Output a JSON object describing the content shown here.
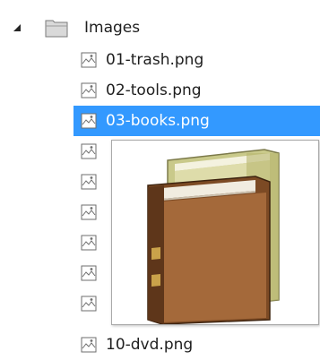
{
  "tree": {
    "folder": {
      "label": "Images",
      "icon": "folder-icon",
      "expanded": true
    },
    "files": [
      {
        "label": "01-trash.png",
        "icon": "image-file-icon"
      },
      {
        "label": "02-tools.png",
        "icon": "image-file-icon"
      },
      {
        "label": "03-books.png",
        "icon": "image-file-icon",
        "selected": true
      },
      {
        "label": "",
        "icon": "image-file-icon"
      },
      {
        "label": "",
        "icon": "image-file-icon"
      },
      {
        "label": "",
        "icon": "image-file-icon"
      },
      {
        "label": "",
        "icon": "image-file-icon"
      },
      {
        "label": "",
        "icon": "image-file-icon"
      },
      {
        "label": "",
        "icon": "image-file-icon"
      },
      {
        "label": "10-dvd.png",
        "icon": "image-file-icon"
      }
    ]
  },
  "preview": {
    "image": "books-icon"
  },
  "colors": {
    "selection": "#3399ff",
    "selection_text": "#ffffff"
  }
}
